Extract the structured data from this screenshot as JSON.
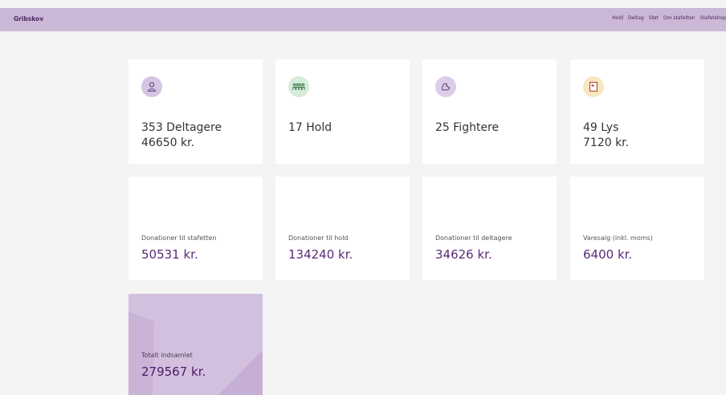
{
  "header": {
    "brand": "Gribskov",
    "nav": [
      "Hold",
      "Deltag",
      "Støt",
      "Om stafetten",
      "Stafetshop"
    ]
  },
  "stats": [
    {
      "icon": "person-icon",
      "color": "#d6c4e3",
      "line1": "353 Deltagere",
      "line2": "46650 kr."
    },
    {
      "icon": "team-icon",
      "color": "#d4ecd9",
      "line1": "17 Hold",
      "line2": ""
    },
    {
      "icon": "fighter-icon",
      "color": "#dccdea",
      "line1": "25 Fightere",
      "line2": ""
    },
    {
      "icon": "candle-bag-icon",
      "color": "#f7e7c1",
      "line1": "49 Lys",
      "line2": "7120 kr."
    }
  ],
  "donations": [
    {
      "label": "Donationer til stafetten",
      "value": "50531 kr."
    },
    {
      "label": "Donationer til hold",
      "value": "134240 kr."
    },
    {
      "label": "Donationer til deltagere",
      "value": "34626 kr."
    },
    {
      "label": "Varesalg (inkl. moms)",
      "value": "6400 kr."
    }
  ],
  "total": {
    "label": "Totalt indsamlet",
    "value": "279567 kr."
  }
}
